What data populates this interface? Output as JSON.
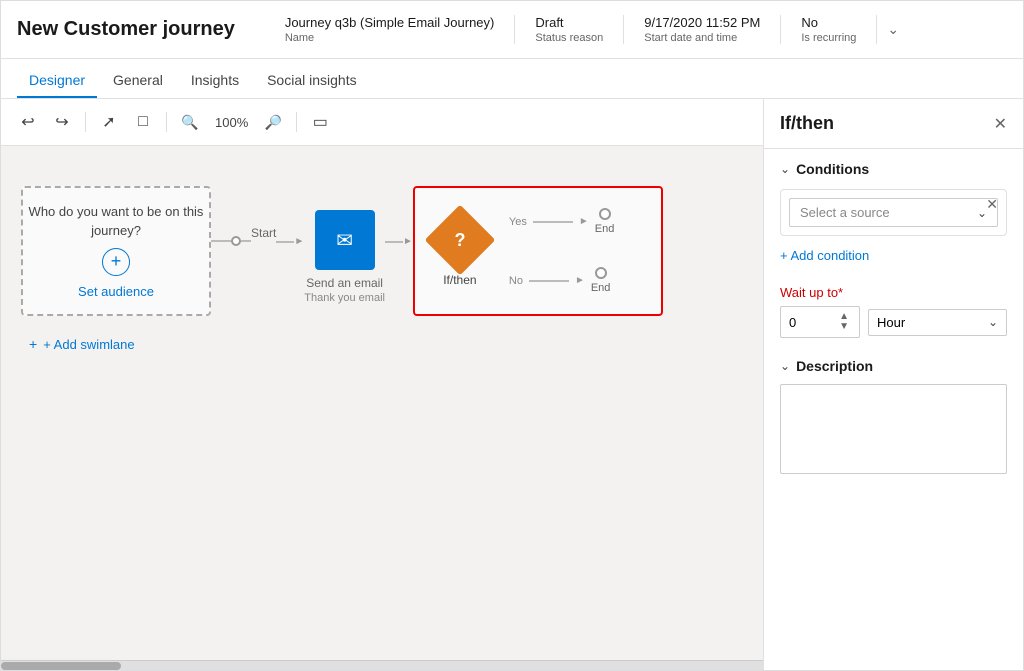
{
  "header": {
    "title": "New Customer journey",
    "journey_name": "Journey q3b (Simple Email Journey)",
    "journey_name_label": "Name",
    "status_value": "Draft",
    "status_label": "Status reason",
    "datetime_value": "9/17/2020 11:52 PM",
    "datetime_label": "Start date and time",
    "recurring_value": "No",
    "recurring_label": "Is recurring"
  },
  "nav": {
    "tabs": [
      {
        "label": "Designer",
        "active": true
      },
      {
        "label": "General",
        "active": false
      },
      {
        "label": "Insights",
        "active": false
      },
      {
        "label": "Social insights",
        "active": false
      }
    ]
  },
  "toolbar": {
    "undo_icon": "↩",
    "redo_icon": "↪",
    "zoom_in_icon": "⤢",
    "split_icon": "⊟",
    "zoom_level": "100%",
    "zoom_out_icon": "🔍",
    "fullscreen_icon": "⛶"
  },
  "canvas": {
    "audience_text": "Who do you want to be on this journey?",
    "audience_link": "Set audience",
    "start_label": "Start",
    "email_label": "Send an email",
    "email_sublabel": "Thank you email",
    "ifthen_label": "If/then",
    "yes_label": "Yes",
    "no_label": "No",
    "end_label": "End",
    "add_swimlane_label": "+ Add swimlane"
  },
  "panel": {
    "title": "If/then",
    "conditions_label": "Conditions",
    "select_source_placeholder": "Select a source",
    "add_condition_label": "+ Add condition",
    "wait_label": "Wait up to",
    "wait_value": "0",
    "wait_unit": "Hour",
    "description_label": "Description",
    "description_placeholder": ""
  }
}
